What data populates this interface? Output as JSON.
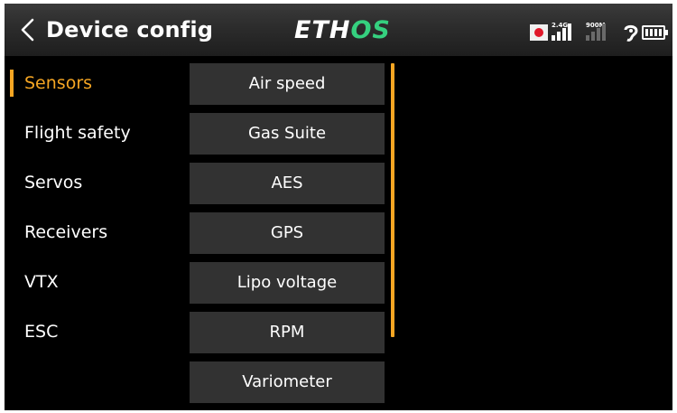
{
  "header": {
    "back_icon": "chevron-left-icon",
    "title": "Device config",
    "brand_main": "ETH",
    "brand_accent": "OS",
    "brand_accent_color": "#35d07f"
  },
  "status": {
    "record_icon": "record-icon",
    "signal_1_label": "2.4G",
    "signal_2_label": "900M",
    "audio_icon": "ear-icon",
    "battery_icon": "battery-icon"
  },
  "menu": {
    "accent_color": "#f6a623",
    "items": [
      {
        "label": "Sensors",
        "active": true
      },
      {
        "label": "Flight safety",
        "active": false
      },
      {
        "label": "Servos",
        "active": false
      },
      {
        "label": "Receivers",
        "active": false
      },
      {
        "label": "VTX",
        "active": false
      },
      {
        "label": "ESC",
        "active": false
      }
    ]
  },
  "sensors": {
    "items": [
      "Air speed",
      "Gas Suite",
      "AES",
      "GPS",
      "Lipo voltage",
      "RPM",
      "Variometer"
    ]
  }
}
